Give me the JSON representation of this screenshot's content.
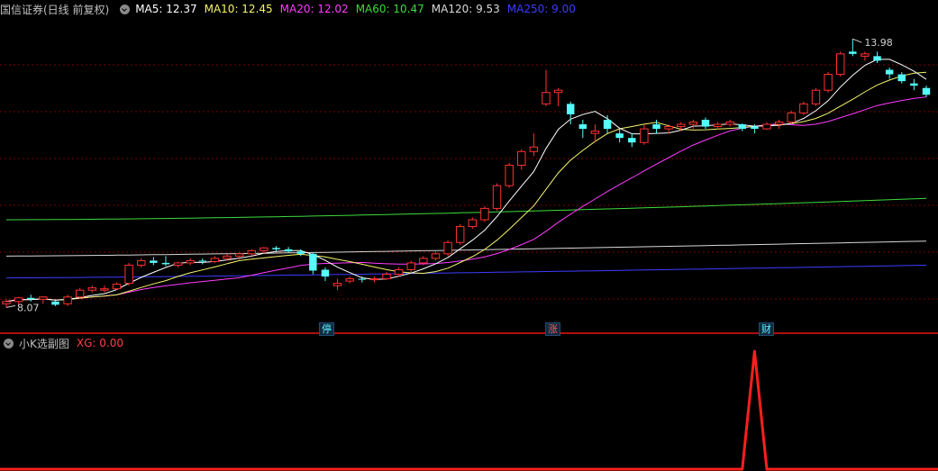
{
  "header": {
    "title": "国信证券(日线 前复权)",
    "indicators": [
      {
        "label": "MA5: 12.37",
        "color": "#ffffff"
      },
      {
        "label": "MA10: 12.45",
        "color": "#f5f56b"
      },
      {
        "label": "MA20: 12.02",
        "color": "#ff3cff"
      },
      {
        "label": "MA60: 10.47",
        "color": "#3cdc3c"
      },
      {
        "label": "MA120: 9.53",
        "color": "#d8d8d8"
      },
      {
        "label": "MA250: 9.00",
        "color": "#3c3cff"
      }
    ]
  },
  "sub_header": {
    "title": "小K选副图",
    "indicator": "XG: 0.00"
  },
  "markers": [
    {
      "text": "停",
      "color": "#5ff0ff",
      "at": 26
    },
    {
      "text": "涨",
      "color": "#ff5555",
      "at": 45
    },
    {
      "text": "财",
      "color": "#5ff0ff",
      "at": 62
    }
  ],
  "colors": {
    "up": "#ff3232",
    "down": "#54fcfc",
    "grid": "#7a0000",
    "xg": "#ff1e1e"
  },
  "chart_data": {
    "type": "candlestick",
    "ylim": [
      7.8,
      14.4
    ],
    "max_label": "13.98",
    "min_label": "8.07",
    "candles": [
      [
        8.15,
        8.25,
        8.07,
        8.2
      ],
      [
        8.2,
        8.3,
        8.12,
        8.28
      ],
      [
        8.28,
        8.35,
        8.2,
        8.25
      ],
      [
        8.25,
        8.32,
        8.15,
        8.3
      ],
      [
        8.2,
        8.25,
        8.1,
        8.13
      ],
      [
        8.15,
        8.35,
        8.1,
        8.3
      ],
      [
        8.3,
        8.5,
        8.25,
        8.45
      ],
      [
        8.45,
        8.55,
        8.4,
        8.5
      ],
      [
        8.45,
        8.55,
        8.4,
        8.48
      ],
      [
        8.48,
        8.62,
        8.45,
        8.58
      ],
      [
        8.6,
        9.05,
        8.55,
        9.0
      ],
      [
        9.0,
        9.15,
        8.95,
        9.1
      ],
      [
        9.1,
        9.18,
        9.0,
        9.05
      ],
      [
        9.05,
        9.2,
        8.98,
        9.02
      ],
      [
        9.0,
        9.08,
        8.95,
        9.05
      ],
      [
        9.05,
        9.15,
        9.0,
        9.1
      ],
      [
        9.1,
        9.15,
        9.02,
        9.08
      ],
      [
        9.08,
        9.2,
        9.05,
        9.15
      ],
      [
        9.15,
        9.25,
        9.1,
        9.2
      ],
      [
        9.2,
        9.28,
        9.12,
        9.25
      ],
      [
        9.25,
        9.35,
        9.2,
        9.32
      ],
      [
        9.32,
        9.4,
        9.25,
        9.38
      ],
      [
        9.38,
        9.42,
        9.3,
        9.35
      ],
      [
        9.35,
        9.4,
        9.28,
        9.3
      ],
      [
        9.3,
        9.35,
        9.2,
        9.25
      ],
      [
        9.25,
        9.28,
        8.8,
        8.88
      ],
      [
        8.9,
        8.95,
        8.65,
        8.75
      ],
      [
        8.55,
        8.7,
        8.45,
        8.6
      ],
      [
        8.65,
        8.75,
        8.6,
        8.7
      ],
      [
        8.7,
        8.75,
        8.62,
        8.68
      ],
      [
        8.68,
        8.75,
        8.62,
        8.7
      ],
      [
        8.7,
        8.85,
        8.68,
        8.8
      ],
      [
        8.8,
        8.95,
        8.75,
        8.9
      ],
      [
        8.9,
        9.1,
        8.85,
        9.05
      ],
      [
        9.05,
        9.2,
        9.0,
        9.15
      ],
      [
        9.15,
        9.3,
        9.1,
        9.25
      ],
      [
        9.25,
        9.55,
        9.2,
        9.5
      ],
      [
        9.5,
        9.9,
        9.45,
        9.85
      ],
      [
        9.85,
        10.05,
        9.8,
        10.0
      ],
      [
        10.0,
        10.3,
        9.95,
        10.25
      ],
      [
        10.25,
        10.8,
        10.2,
        10.75
      ],
      [
        10.75,
        11.25,
        10.7,
        11.2
      ],
      [
        11.2,
        11.55,
        11.1,
        11.5
      ],
      [
        11.5,
        11.9,
        11.4,
        11.6
      ],
      [
        12.55,
        13.3,
        12.5,
        12.8
      ],
      [
        12.8,
        12.9,
        12.5,
        12.85
      ],
      [
        12.55,
        12.6,
        12.1,
        12.32
      ],
      [
        12.1,
        12.2,
        11.8,
        12.0
      ],
      [
        11.9,
        12.1,
        11.7,
        11.95
      ],
      [
        12.2,
        12.3,
        11.9,
        12.0
      ],
      [
        11.9,
        12.0,
        11.7,
        11.8
      ],
      [
        11.8,
        11.9,
        11.6,
        11.7
      ],
      [
        11.7,
        12.1,
        11.65,
        12.0
      ],
      [
        12.1,
        12.2,
        11.9,
        12.0
      ],
      [
        12.0,
        12.1,
        11.9,
        12.05
      ],
      [
        12.05,
        12.15,
        11.95,
        12.1
      ],
      [
        12.1,
        12.2,
        12.0,
        12.15
      ],
      [
        12.2,
        12.25,
        12.0,
        12.05
      ],
      [
        12.05,
        12.15,
        11.98,
        12.1
      ],
      [
        12.1,
        12.2,
        12.05,
        12.15
      ],
      [
        12.1,
        12.12,
        11.95,
        12.0
      ],
      [
        12.05,
        12.1,
        11.9,
        12.0
      ],
      [
        12.0,
        12.15,
        11.98,
        12.1
      ],
      [
        12.1,
        12.2,
        12.0,
        12.15
      ],
      [
        12.15,
        12.4,
        12.1,
        12.35
      ],
      [
        12.35,
        12.6,
        12.3,
        12.55
      ],
      [
        12.55,
        12.9,
        12.5,
        12.85
      ],
      [
        12.85,
        13.25,
        12.8,
        13.2
      ],
      [
        13.2,
        13.7,
        13.15,
        13.65
      ],
      [
        13.7,
        13.75,
        13.6,
        13.65
      ],
      [
        13.6,
        13.7,
        13.5,
        13.65
      ],
      [
        13.6,
        13.7,
        13.45,
        13.5
      ],
      [
        13.3,
        13.35,
        13.1,
        13.2
      ],
      [
        13.2,
        13.25,
        13.0,
        13.05
      ],
      [
        13.0,
        13.1,
        12.85,
        12.95
      ],
      [
        12.9,
        12.95,
        12.7,
        12.75
      ]
    ],
    "xg": [
      0,
      0,
      0,
      0,
      0,
      0,
      0,
      0,
      0,
      0,
      0,
      0,
      0,
      0,
      0,
      0,
      0,
      0,
      0,
      0,
      0,
      0,
      0,
      0,
      0,
      0,
      0,
      0,
      0,
      0,
      0,
      0,
      0,
      0,
      0,
      0,
      0,
      0,
      0,
      0,
      0,
      0,
      0,
      0,
      0,
      0,
      0,
      0,
      0,
      0,
      0,
      0,
      0,
      0,
      0,
      0,
      0,
      0,
      0,
      0,
      0,
      1,
      0,
      0,
      0,
      0,
      0,
      0,
      0,
      0,
      0,
      0,
      0,
      0,
      0,
      0
    ],
    "ma_long": [
      {
        "name": "MA60",
        "start": 10.0,
        "end": 10.47
      },
      {
        "name": "MA120",
        "start": 9.2,
        "end": 9.53
      },
      {
        "name": "MA250",
        "start": 8.72,
        "end": 9.0
      }
    ]
  }
}
